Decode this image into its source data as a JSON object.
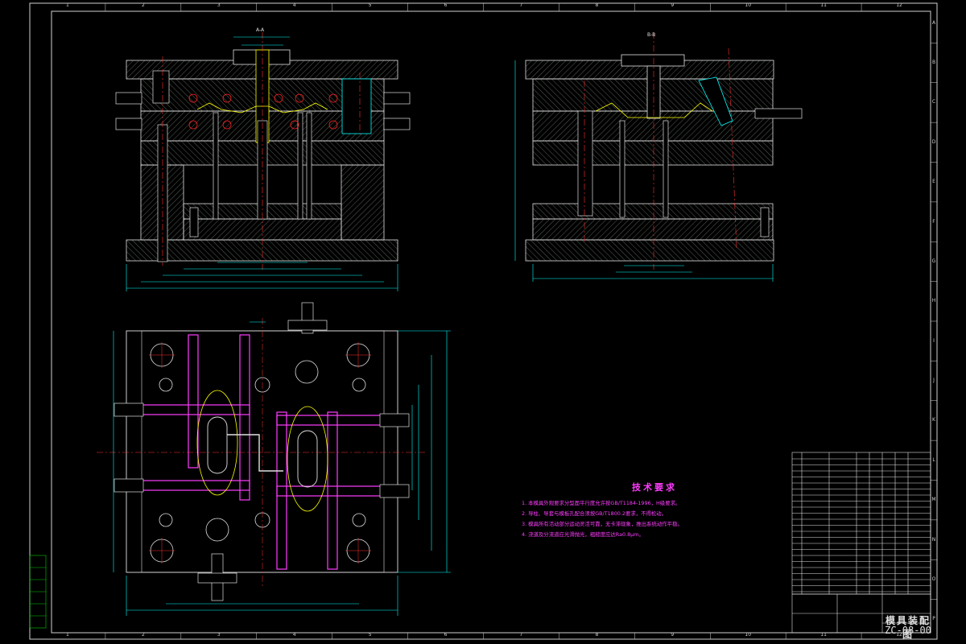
{
  "drawing": {
    "title_block": {
      "name": "模具装配图",
      "code": "ZC-08-00"
    },
    "view_labels": {
      "section_a": "A-A",
      "section_b": "B-B"
    },
    "technical_requirements": {
      "title": "技术要求",
      "items": [
        "1. 本模具外观要求分型面平行度允许按GB/T1184-1996，H级要求。",
        "2. 导柱、导套与模板孔配合须按GB/T1800.2要求，不得松动。",
        "3. 模具所有活动部分运动灵活可靠，无卡滞现象，推出系统动作平稳。",
        "4. 浇道及分流道应光滑抛光，粗糙度应达Ra0.8μm。"
      ]
    },
    "zone_numbers": [
      "1",
      "2",
      "3",
      "4",
      "5",
      "6",
      "7",
      "8",
      "9",
      "10",
      "11",
      "12"
    ],
    "zone_letters": [
      "A",
      "B",
      "C",
      "D",
      "E",
      "F",
      "G",
      "H",
      "I",
      "J",
      "K",
      "L",
      "M",
      "N",
      "O",
      "P"
    ]
  }
}
